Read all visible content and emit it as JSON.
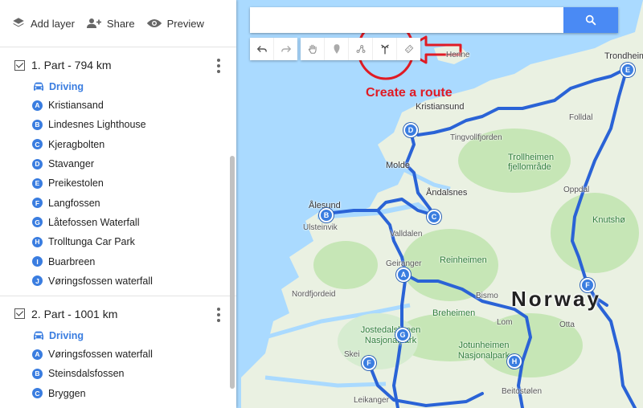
{
  "toolbar": {
    "add_layer": "Add layer",
    "share": "Share",
    "preview": "Preview"
  },
  "layers": [
    {
      "title": "1. Part - 794 km",
      "mode": "Driving",
      "stops": [
        {
          "letter": "A",
          "name": "Kristiansand"
        },
        {
          "letter": "B",
          "name": "Lindesnes Lighthouse"
        },
        {
          "letter": "C",
          "name": "Kjeragbolten"
        },
        {
          "letter": "D",
          "name": "Stavanger"
        },
        {
          "letter": "E",
          "name": "Preikestolen"
        },
        {
          "letter": "F",
          "name": "Langfossen"
        },
        {
          "letter": "G",
          "name": "Låtefossen Waterfall"
        },
        {
          "letter": "H",
          "name": "Trolltunga Car Park"
        },
        {
          "letter": "I",
          "name": "Buarbreen"
        },
        {
          "letter": "J",
          "name": "Vøringsfossen waterfall"
        }
      ]
    },
    {
      "title": "2. Part - 1001 km",
      "mode": "Driving",
      "stops": [
        {
          "letter": "A",
          "name": "Vøringsfossen waterfall"
        },
        {
          "letter": "B",
          "name": "Steinsdalsfossen"
        },
        {
          "letter": "C",
          "name": "Bryggen"
        }
      ]
    }
  ],
  "search": {
    "placeholder": "",
    "value": ""
  },
  "annotation": "Create a route",
  "map": {
    "labels": {
      "trondheim": "Trondheim",
      "kristiansund": "Kristiansund",
      "tingvoll": "Tingvollfjorden",
      "trollheimen": "Trollheimen fjellområde",
      "molde": "Molde",
      "andalsnes": "Åndalsnes",
      "alesund": "Ålesund",
      "ulsteinvik": "Ulsteinvik",
      "valldalen": "Valldalen",
      "reinheimen": "Reinheimen",
      "geiranger": "Geiranger",
      "norfjordeid": "Nordfjordeid",
      "breheimen": "Breheimen",
      "jostedalsbreen": "Jostedalsbreen Nasjonalpark",
      "jotunheimen": "Jotunheimen Nasjonalpark",
      "norway": "Norway",
      "otta": "Otta",
      "knutsho": "Knutshø",
      "oppdal": "Oppdal",
      "lom": "Lom",
      "skei": "Skei",
      "leikanger": "Leikanger",
      "beitostolen": "Beitostølen",
      "bismo": "Bismo",
      "henne": "Henne",
      "folldal": "Folldal"
    },
    "markers": [
      "E",
      "D",
      "B",
      "C",
      "A",
      "F",
      "G",
      "H",
      "F"
    ],
    "colors": {
      "route": "#2a63d6",
      "water": "#aadaff",
      "land": "#eaf1e2",
      "park": "#c6e6b6",
      "accent": "#e01b24",
      "search_button": "#4a8af4"
    }
  }
}
